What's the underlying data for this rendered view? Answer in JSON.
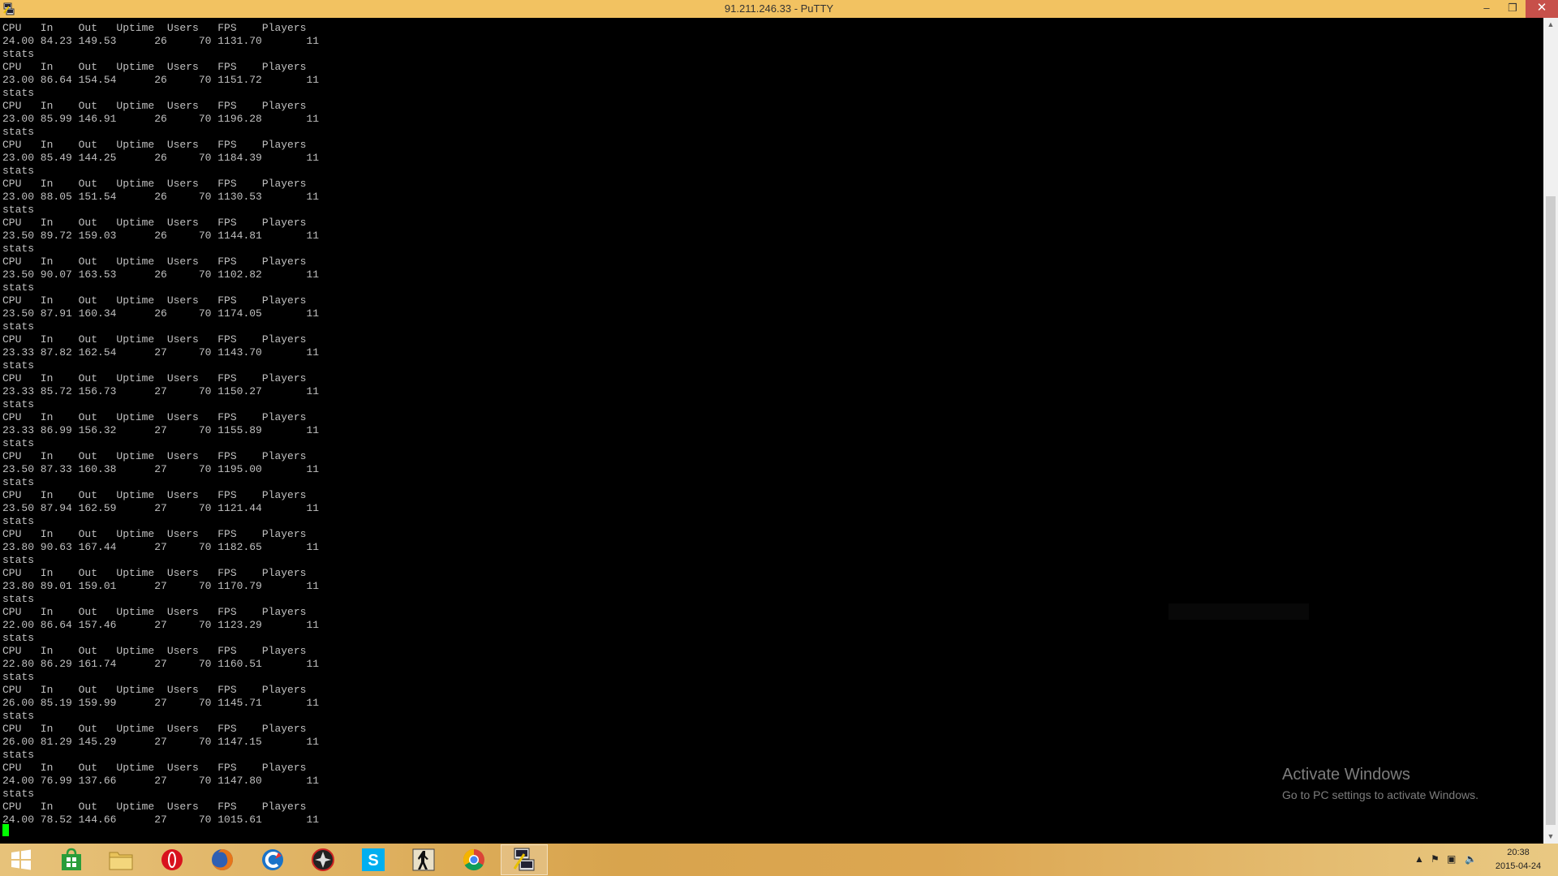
{
  "window": {
    "title": "91.211.246.33 - PuTTY",
    "minimize_glyph": "–",
    "maximize_glyph": "❐",
    "close_glyph": "✕"
  },
  "terminal": {
    "lines": [
      "CPU   In    Out   Uptime  Users   FPS    Players",
      "24.00 84.23 149.53      26     70 1131.70       11",
      "stats",
      "CPU   In    Out   Uptime  Users   FPS    Players",
      "23.00 86.64 154.54      26     70 1151.72       11",
      "stats",
      "CPU   In    Out   Uptime  Users   FPS    Players",
      "23.00 85.99 146.91      26     70 1196.28       11",
      "stats",
      "CPU   In    Out   Uptime  Users   FPS    Players",
      "23.00 85.49 144.25      26     70 1184.39       11",
      "stats",
      "CPU   In    Out   Uptime  Users   FPS    Players",
      "23.00 88.05 151.54      26     70 1130.53       11",
      "stats",
      "CPU   In    Out   Uptime  Users   FPS    Players",
      "23.50 89.72 159.03      26     70 1144.81       11",
      "stats",
      "CPU   In    Out   Uptime  Users   FPS    Players",
      "23.50 90.07 163.53      26     70 1102.82       11",
      "stats",
      "CPU   In    Out   Uptime  Users   FPS    Players",
      "23.50 87.91 160.34      26     70 1174.05       11",
      "stats",
      "CPU   In    Out   Uptime  Users   FPS    Players",
      "23.33 87.82 162.54      27     70 1143.70       11",
      "stats",
      "CPU   In    Out   Uptime  Users   FPS    Players",
      "23.33 85.72 156.73      27     70 1150.27       11",
      "stats",
      "CPU   In    Out   Uptime  Users   FPS    Players",
      "23.33 86.99 156.32      27     70 1155.89       11",
      "stats",
      "CPU   In    Out   Uptime  Users   FPS    Players",
      "23.50 87.33 160.38      27     70 1195.00       11",
      "stats",
      "CPU   In    Out   Uptime  Users   FPS    Players",
      "23.50 87.94 162.59      27     70 1121.44       11",
      "stats",
      "CPU   In    Out   Uptime  Users   FPS    Players",
      "23.80 90.63 167.44      27     70 1182.65       11",
      "stats",
      "CPU   In    Out   Uptime  Users   FPS    Players",
      "23.80 89.01 159.01      27     70 1170.79       11",
      "stats",
      "CPU   In    Out   Uptime  Users   FPS    Players",
      "22.00 86.64 157.46      27     70 1123.29       11",
      "stats",
      "CPU   In    Out   Uptime  Users   FPS    Players",
      "22.80 86.29 161.74      27     70 1160.51       11",
      "stats",
      "CPU   In    Out   Uptime  Users   FPS    Players",
      "26.00 85.19 159.99      27     70 1145.71       11",
      "stats",
      "CPU   In    Out   Uptime  Users   FPS    Players",
      "26.00 81.29 145.29      27     70 1147.15       11",
      "stats",
      "CPU   In    Out   Uptime  Users   FPS    Players",
      "24.00 76.99 137.66      27     70 1147.80       11",
      "stats",
      "CPU   In    Out   Uptime  Users   FPS    Players",
      "24.00 78.52 144.66      27     70 1015.61       11"
    ],
    "cursor_color": "#00ff00",
    "text_color": "#c0c0c0",
    "background": "#000000"
  },
  "watermark": {
    "title": "Activate Windows",
    "subtitle": "Go to PC settings to activate Windows."
  },
  "taskbar": {
    "items": [
      {
        "name": "start-button",
        "icon": "windows-logo-icon"
      },
      {
        "name": "store",
        "icon": "store-icon"
      },
      {
        "name": "file-explorer",
        "icon": "folder-icon"
      },
      {
        "name": "opera",
        "icon": "opera-icon"
      },
      {
        "name": "firefox",
        "icon": "firefox-icon"
      },
      {
        "name": "ccleaner",
        "icon": "ccleaner-icon"
      },
      {
        "name": "game-app",
        "icon": "game-icon"
      },
      {
        "name": "skype",
        "icon": "skype-icon"
      },
      {
        "name": "counter-strike",
        "icon": "counter-strike-icon"
      },
      {
        "name": "chrome",
        "icon": "chrome-icon"
      },
      {
        "name": "putty",
        "icon": "putty-icon",
        "active": true
      }
    ],
    "tray": {
      "time": "20:38",
      "date": "2015-04-24"
    }
  }
}
